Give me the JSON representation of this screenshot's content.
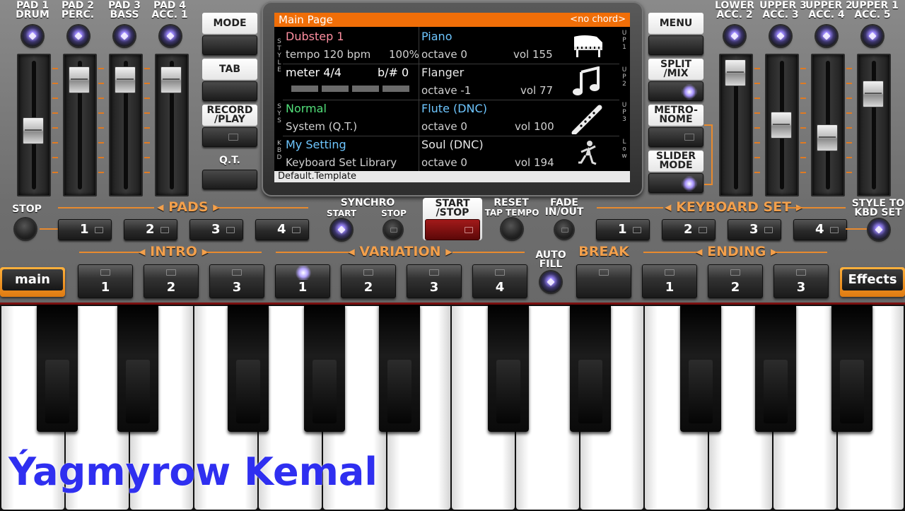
{
  "pads_top": [
    {
      "line1": "PAD 1",
      "line2": "DRUM"
    },
    {
      "line1": "PAD 2",
      "line2": "PERC."
    },
    {
      "line1": "PAD 3",
      "line2": "BASS"
    },
    {
      "line1": "PAD 4",
      "line2": "ACC. 1"
    }
  ],
  "acc_top": [
    {
      "line1": "LOWER",
      "line2": "ACC. 2"
    },
    {
      "line1": "UPPER 3",
      "line2": "ACC. 3"
    },
    {
      "line1": "UPPER 2",
      "line2": "ACC. 4"
    },
    {
      "line1": "UPPER 1",
      "line2": "ACC. 5"
    }
  ],
  "left_buttons": {
    "mode": "MODE",
    "tab": "TAB",
    "record": "RECORD\n/PLAY",
    "qt": "Q.T."
  },
  "right_buttons": {
    "menu": "MENU",
    "split": "SPLIT\n/MIX",
    "metronome": "METRO-\nNOME",
    "slider_mode": "SLIDER\nMODE"
  },
  "display": {
    "title": "Main Page",
    "chord": "<no chord>",
    "footer": "Default.Template",
    "side_left": {
      "style": "STYLE",
      "sys": "SYS",
      "kbd": "KBD"
    },
    "side_right": {
      "up1": "UP1",
      "up2": "UP2",
      "up3": "UP3",
      "low": "Low"
    },
    "style": {
      "name": "Dubstep 1",
      "tempo": "tempo 120 bpm",
      "percent": "100%",
      "meter": "meter 4/4",
      "key": "b/# 0"
    },
    "sys": {
      "name": "Normal",
      "sub": "System (Q.T.)"
    },
    "kbd": {
      "name": "My Setting",
      "sub": "Keyboard Set Library"
    },
    "voices": [
      {
        "name": "Piano",
        "octave": "octave 0",
        "vol": "vol 155",
        "icon": "piano-icon",
        "color": "#6ec6ff"
      },
      {
        "name": "Flanger",
        "octave": "octave -1",
        "vol": "vol 77",
        "icon": "music-note-icon",
        "color": "#e6e6e6"
      },
      {
        "name": "Flute (DNC)",
        "octave": "octave 0",
        "vol": "vol 100",
        "icon": "flute-icon",
        "color": "#6ec6ff"
      },
      {
        "name": "Soul (DNC)",
        "octave": "octave 0",
        "vol": "vol 194",
        "icon": "dancer-icon",
        "color": "#e6e6e6"
      }
    ]
  },
  "labels": {
    "stop": "STOP",
    "pads": "PADS",
    "synchro": "SYNCHRO",
    "synchro_start": "START",
    "synchro_stop": "STOP",
    "start_stop": "START\n/STOP",
    "reset": "RESET",
    "tap_tempo": "TAP TEMPO",
    "fade": "FADE\nIN/OUT",
    "keyboard_set": "KEYBOARD SET",
    "style_to_kbd": "STYLE TO\nKBD SET",
    "intro": "INTRO",
    "variation": "VARIATION",
    "auto_fill": "AUTO\nFILL",
    "break": "BREAK",
    "ending": "ENDING"
  },
  "pad_buttons": [
    "1",
    "2",
    "3",
    "4"
  ],
  "kbd_set_buttons": [
    "1",
    "2",
    "3",
    "4"
  ],
  "intro_buttons": [
    "1",
    "2",
    "3"
  ],
  "variation_buttons": [
    "1",
    "2",
    "3",
    "4"
  ],
  "ending_buttons": [
    "1",
    "2",
    "3"
  ],
  "main_button": "main",
  "effects_button": "Effects",
  "watermark": "Ýagmyrow Kemal"
}
